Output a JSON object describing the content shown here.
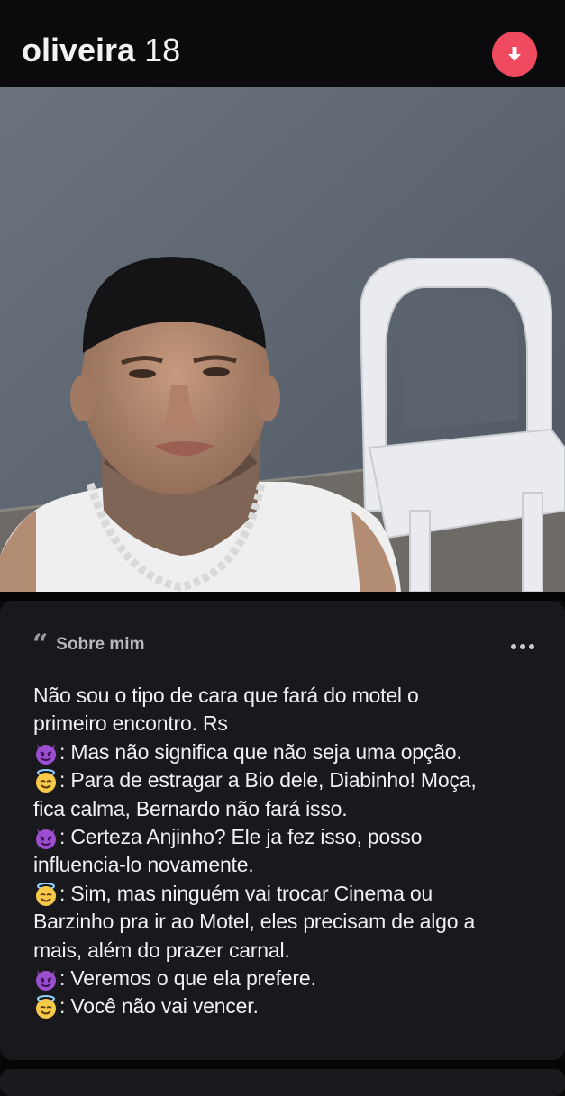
{
  "header": {
    "name": "oliveira",
    "age": "18"
  },
  "colors": {
    "accent": "#f04a60",
    "background": "#0a0a0c",
    "card": "#19191d"
  },
  "icons": {
    "collapse": "arrow-down-icon",
    "quote": "quote-icon",
    "more": "more-dots-icon",
    "devil": "smiling-devil-emoji",
    "angel": "angel-halo-emoji"
  },
  "about": {
    "title": "Sobre mim",
    "lines": [
      {
        "emoji": "",
        "text": "Não sou o tipo de cara que fará do motel o"
      },
      {
        "emoji": "",
        "text": "primeiro encontro. Rs"
      },
      {
        "emoji": "devil",
        "text": ": Mas não significa que não seja uma opção."
      },
      {
        "emoji": "angel",
        "text": ": Para de estragar a Bio dele, Diabinho! Moça,"
      },
      {
        "emoji": "",
        "text": "fica calma, Bernardo não fará isso."
      },
      {
        "emoji": "devil",
        "text": ": Certeza Anjinho? Ele ja fez isso, posso"
      },
      {
        "emoji": "",
        "text": "influencia-lo novamente."
      },
      {
        "emoji": "angel",
        "text": ": Sim, mas ninguém vai trocar Cinema ou"
      },
      {
        "emoji": "",
        "text": "Barzinho pra ir ao Motel, eles precisam de algo a"
      },
      {
        "emoji": "",
        "text": "mais, além do prazer carnal."
      },
      {
        "emoji": "devil",
        "text": ": Veremos o que ela prefere."
      },
      {
        "emoji": "angel",
        "text": ": Você não vai vencer."
      }
    ]
  }
}
